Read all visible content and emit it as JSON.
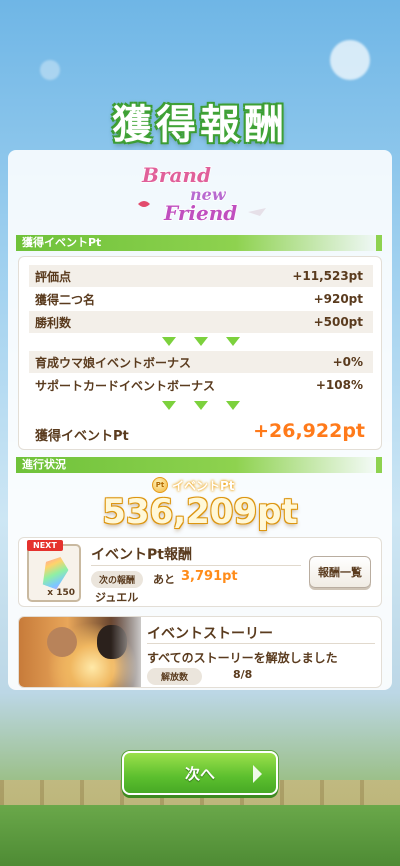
{
  "title": "獲得報酬",
  "logo": {
    "line1": "Brand",
    "line2": "new",
    "line3": "Friend"
  },
  "section_earned": {
    "label": "獲得イベントPt"
  },
  "rows_top": [
    {
      "label": "評価点",
      "value": "+11,523pt"
    },
    {
      "label": "獲得二つ名",
      "value": "+920pt"
    },
    {
      "label": "勝利数",
      "value": "+500pt"
    }
  ],
  "rows_bonus": [
    {
      "label": "育成ウマ娘イベントボーナス",
      "value": "+0%"
    },
    {
      "label": "サポートカードイベントボーナス",
      "value": "+108%"
    }
  ],
  "total": {
    "label": "獲得イベントPt",
    "value": "+26,922pt"
  },
  "section_progress": {
    "label": "進行状況"
  },
  "event_pt": {
    "label": "イベントPt",
    "coin": "Pt",
    "value": "536,209pt"
  },
  "reward_card": {
    "next_tag": "NEXT",
    "qty": "x 150",
    "title": "イベントPt報酬",
    "next_reward_label": "次の報酬",
    "remaining_prefix": "あと",
    "remaining_value": "3,791pt",
    "item_name": "ジュエル",
    "list_button": "報酬一覧"
  },
  "story_card": {
    "title": "イベントストーリー",
    "status": "すべてのストーリーを解放しました",
    "unlocked_label": "解放数",
    "unlocked_value": "8/8"
  },
  "next_button": "次へ",
  "colors": {
    "accent_green": "#6fc23a",
    "highlight_orange": "#ff7a1a",
    "text_brown": "#5a3b1e"
  }
}
